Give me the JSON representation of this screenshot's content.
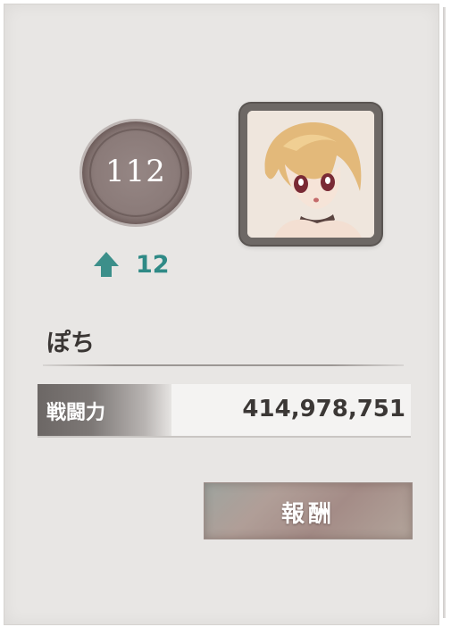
{
  "rank": {
    "value": "112",
    "change": "12",
    "change_direction": "up-arrow-icon"
  },
  "player": {
    "name": "ぽち",
    "avatar": "anime-character-portrait"
  },
  "power": {
    "label": "戦闘力",
    "value": "414,978,751"
  },
  "reward_button": {
    "label": "報酬"
  },
  "colors": {
    "rank_up": "#2f8a86",
    "background": "#e8e6e4"
  }
}
